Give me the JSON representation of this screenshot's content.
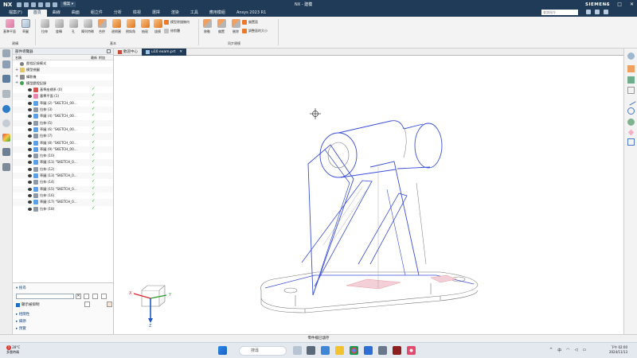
{
  "titlebar": {
    "app_logo": "NX",
    "quick_access_dropdown": "檔案 ▾",
    "window_title": "NX - 建模",
    "brand": "SIEMENS",
    "min": "—",
    "max": "□",
    "close": "✕"
  },
  "menu": {
    "tabs": [
      "檔案(F)",
      "首頁",
      "曲線",
      "曲面",
      "組立件",
      "分析",
      "檢視",
      "選擇",
      "渲染",
      "工具",
      "應用模組",
      "Ansys 2023 R1"
    ],
    "active_index": 1,
    "search_placeholder": "查詢指令",
    "search_hint": "查詢指令"
  },
  "ribbon": {
    "buttons": [
      {
        "label": "基準平面",
        "icon": "datum-plane-icon"
      },
      {
        "label": "草圖",
        "icon": "sketch-icon"
      },
      {
        "label": "拉伸",
        "icon": "extrude-icon"
      },
      {
        "label": "旋轉",
        "icon": "revolve-icon"
      },
      {
        "label": "孔",
        "icon": "hole-icon"
      },
      {
        "label": "陣列特徵",
        "icon": "pattern-feature-icon"
      },
      {
        "label": "合併",
        "icon": "unite-icon"
      },
      {
        "label": "邊倒圓",
        "icon": "edge-blend-icon"
      },
      {
        "label": "倒斜角",
        "icon": "chamfer-icon"
      },
      {
        "label": "抽殼",
        "icon": "shell-icon"
      },
      {
        "label": "拔模",
        "icon": "draft-icon"
      },
      {
        "label": "移動",
        "icon": "move-face-icon"
      },
      {
        "label": "偏置",
        "icon": "offset-face-icon"
      },
      {
        "label": "刪除",
        "icon": "delete-face-icon"
      }
    ],
    "small": [
      "模型除錯幾何",
      "修剪體",
      "調整面的大小",
      "偏置面"
    ],
    "groups": [
      "建構",
      "基本",
      "同步建模"
    ]
  },
  "navigator": {
    "title": "部件導覽器",
    "columns": [
      "名稱",
      "最新",
      "附加"
    ],
    "rows": [
      {
        "indent": 0,
        "label": "歷程記錄模式",
        "kind": "history",
        "check": false
      },
      {
        "indent": 0,
        "label": "模型視圖",
        "kind": "folder",
        "check": false
      },
      {
        "indent": 0,
        "label": "攝影機",
        "kind": "camera",
        "check": false
      },
      {
        "indent": 0,
        "label": "模型歷程記錄",
        "kind": "model",
        "check": false
      },
      {
        "indent": 1,
        "label": "基準座標系 (0)",
        "kind": "csys",
        "check": true
      },
      {
        "indent": 1,
        "label": "基準平面 (1)",
        "kind": "plane",
        "check": true
      },
      {
        "indent": 1,
        "label": "草圖 (2) \"SKETCH_00...",
        "kind": "sketch",
        "check": true
      },
      {
        "indent": 1,
        "label": "拉伸 (3)",
        "kind": "extrude",
        "check": true
      },
      {
        "indent": 1,
        "label": "草圖 (4) \"SKETCH_00...",
        "kind": "sketch",
        "check": true
      },
      {
        "indent": 1,
        "label": "拉伸 (5)",
        "kind": "extrude",
        "check": true
      },
      {
        "indent": 1,
        "label": "草圖 (6) \"SKETCH_00...",
        "kind": "sketch",
        "check": true
      },
      {
        "indent": 1,
        "label": "拉伸 (7)",
        "kind": "extrude",
        "check": true
      },
      {
        "indent": 1,
        "label": "草圖 (8) \"SKETCH_00...",
        "kind": "sketch",
        "check": true
      },
      {
        "indent": 1,
        "label": "草圖 (9) \"SKETCH_00...",
        "kind": "sketch",
        "check": true
      },
      {
        "indent": 1,
        "label": "拉伸 (10)",
        "kind": "extrude",
        "check": true
      },
      {
        "indent": 1,
        "label": "草圖 (11) \"SKETCH_0...",
        "kind": "sketch",
        "check": true
      },
      {
        "indent": 1,
        "label": "拉伸 (12)",
        "kind": "extrude",
        "check": true
      },
      {
        "indent": 1,
        "label": "草圖 (13) \"SKETCH_0...",
        "kind": "sketch",
        "check": true
      },
      {
        "indent": 1,
        "label": "拉伸 (14)",
        "kind": "extrude",
        "check": true
      },
      {
        "indent": 1,
        "label": "草圖 (15) \"SKETCH_0...",
        "kind": "sketch",
        "check": true
      },
      {
        "indent": 1,
        "label": "拉伸 (16)",
        "kind": "extrude",
        "check": true
      },
      {
        "indent": 1,
        "label": "草圖 (17) \"SKETCH_0...",
        "kind": "sketch",
        "check": true
      },
      {
        "indent": 1,
        "label": "拉伸 (18)",
        "kind": "extrude",
        "check": true
      }
    ]
  },
  "subpanel": {
    "search_title": "搜尋",
    "show_suppressed": "顯示被抑制",
    "sections": [
      "相關性",
      "細節",
      "預覽"
    ]
  },
  "doctabs": [
    {
      "label": "歡迎中心",
      "active": false
    },
    {
      "label": "u10 exam.prt",
      "active": true
    }
  ],
  "triad": {
    "x": "X",
    "y": "Y",
    "z": "Z"
  },
  "statusbar": {
    "text": "零件檔已儲存"
  },
  "taskbar": {
    "weather_temp": "28°C",
    "weather_desc": "多雲時晴",
    "search": "搜尋",
    "time": "下午 02:00",
    "date": "2024/11/13",
    "tray_lang": "中",
    "alert_badge": "1"
  },
  "colors": {
    "titlebar": "#1f3b57",
    "model_edge": "#3b4fd8",
    "check": "#2aa52a",
    "shadow": "#f3d0d8"
  }
}
